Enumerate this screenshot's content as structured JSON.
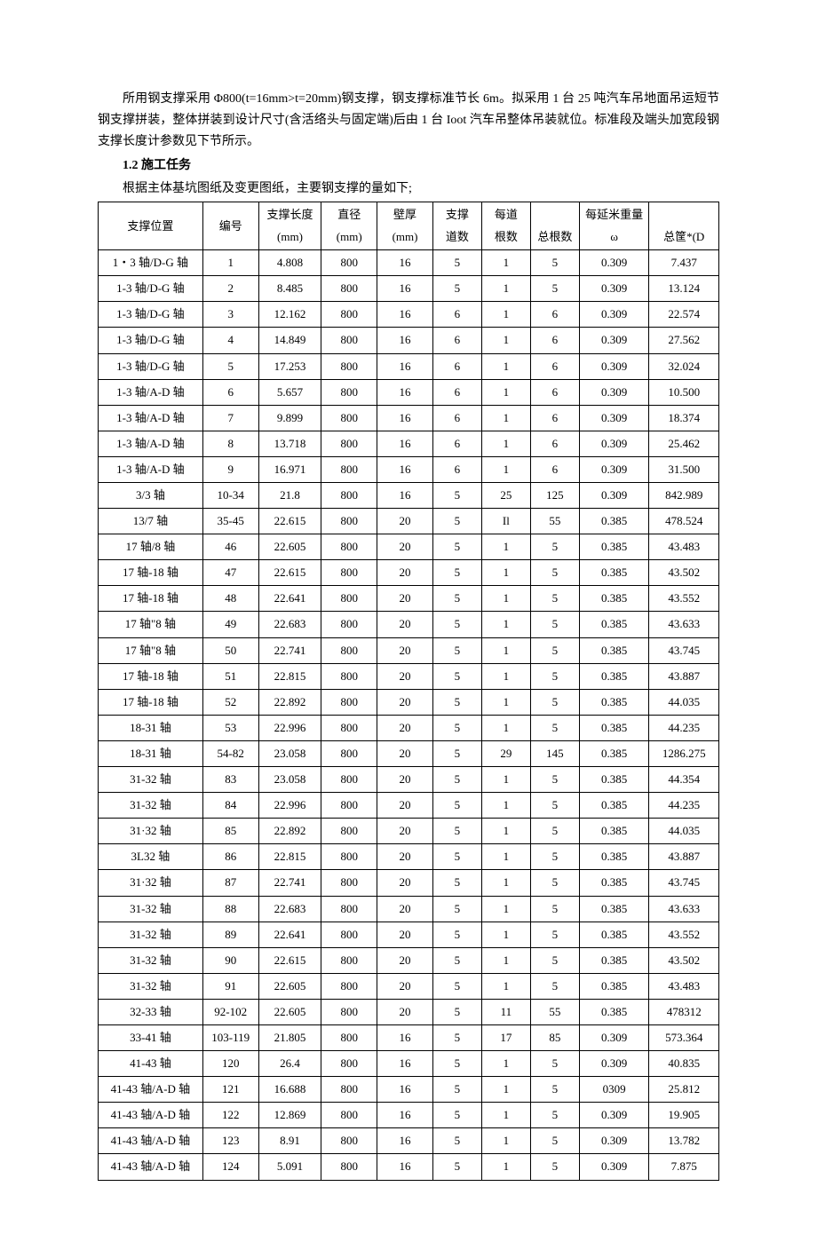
{
  "intro_paragraph": "所用钢支撑采用 Φ800(t=16mm>t=20mm)钢支撑，钢支撑标准节长 6m。拟采用 1 台 25 吨汽车吊地面吊运短节钢支撑拼装，整体拼装到设计尺寸(含活络头与固定端)后由 1 台 Ioot 汽车吊整体吊装就位。标准段及端头加宽段钢支撑长度计参数见下节所示。",
  "section_heading": "1.2 施工任务",
  "intro_line_2": "根据主体基坑图纸及变更图纸，主要钢支撑的量如下;",
  "headers": {
    "pos": "支撑位置",
    "num": "编号",
    "len_top": "支撑长度",
    "len_sub": "(mm)",
    "dia_top": "直径",
    "dia_sub": "(mm)",
    "thk_top": "壁厚",
    "thk_sub": "(mm)",
    "lanes_top": "支撑",
    "lanes_sub": "道数",
    "per_top": "每道",
    "per_sub": "根数",
    "total_sub": "总根数",
    "perm_top": "每延米重量",
    "perm_sub": "ω",
    "sum_sub": "总筐*(D"
  },
  "rows": [
    {
      "pos": "1・3 轴/D-G 轴",
      "num": "1",
      "len": "4.808",
      "dia": "800",
      "thk": "16",
      "lanes": "5",
      "per": "1",
      "total": "5",
      "perm": "0.309",
      "sum": "7.437"
    },
    {
      "pos": "1-3 轴/D-G 轴",
      "num": "2",
      "len": "8.485",
      "dia": "800",
      "thk": "16",
      "lanes": "5",
      "per": "1",
      "total": "5",
      "perm": "0.309",
      "sum": "13.124"
    },
    {
      "pos": "1-3 轴/D-G 轴",
      "num": "3",
      "len": "12.162",
      "dia": "800",
      "thk": "16",
      "lanes": "6",
      "per": "1",
      "total": "6",
      "perm": "0.309",
      "sum": "22.574"
    },
    {
      "pos": "1-3 轴/D-G 轴",
      "num": "4",
      "len": "14.849",
      "dia": "800",
      "thk": "16",
      "lanes": "6",
      "per": "1",
      "total": "6",
      "perm": "0.309",
      "sum": "27.562"
    },
    {
      "pos": "1-3 轴/D-G 轴",
      "num": "5",
      "len": "17.253",
      "dia": "800",
      "thk": "16",
      "lanes": "6",
      "per": "1",
      "total": "6",
      "perm": "0.309",
      "sum": "32.024"
    },
    {
      "pos": "1-3 轴/A-D 轴",
      "num": "6",
      "len": "5.657",
      "dia": "800",
      "thk": "16",
      "lanes": "6",
      "per": "1",
      "total": "6",
      "perm": "0.309",
      "sum": "10.500"
    },
    {
      "pos": "1-3 轴/A-D 轴",
      "num": "7",
      "len": "9.899",
      "dia": "800",
      "thk": "16",
      "lanes": "6",
      "per": "1",
      "total": "6",
      "perm": "0.309",
      "sum": "18.374"
    },
    {
      "pos": "1-3 轴/A-D 轴",
      "num": "8",
      "len": "13.718",
      "dia": "800",
      "thk": "16",
      "lanes": "6",
      "per": "1",
      "total": "6",
      "perm": "0.309",
      "sum": "25.462"
    },
    {
      "pos": "1-3 轴/A-D 轴",
      "num": "9",
      "len": "16.971",
      "dia": "800",
      "thk": "16",
      "lanes": "6",
      "per": "1",
      "total": "6",
      "perm": "0.309",
      "sum": "31.500"
    },
    {
      "pos": "3/3 轴",
      "num": "10-34",
      "len": "21.8",
      "dia": "800",
      "thk": "16",
      "lanes": "5",
      "per": "25",
      "total": "125",
      "perm": "0.309",
      "sum": "842.989"
    },
    {
      "pos": "13/7 轴",
      "num": "35-45",
      "len": "22.615",
      "dia": "800",
      "thk": "20",
      "lanes": "5",
      "per": "Il",
      "total": "55",
      "perm": "0.385",
      "sum": "478.524"
    },
    {
      "pos": "17 轴/8 轴",
      "num": "46",
      "len": "22.605",
      "dia": "800",
      "thk": "20",
      "lanes": "5",
      "per": "1",
      "total": "5",
      "perm": "0.385",
      "sum": "43.483"
    },
    {
      "pos": "17 轴-18 轴",
      "num": "47",
      "len": "22.615",
      "dia": "800",
      "thk": "20",
      "lanes": "5",
      "per": "1",
      "total": "5",
      "perm": "0.385",
      "sum": "43.502"
    },
    {
      "pos": "17 轴-18 轴",
      "num": "48",
      "len": "22.641",
      "dia": "800",
      "thk": "20",
      "lanes": "5",
      "per": "1",
      "total": "5",
      "perm": "0.385",
      "sum": "43.552"
    },
    {
      "pos": "17 轴\"8 轴",
      "num": "49",
      "len": "22.683",
      "dia": "800",
      "thk": "20",
      "lanes": "5",
      "per": "1",
      "total": "5",
      "perm": "0.385",
      "sum": "43.633"
    },
    {
      "pos": "17 轴\"8 轴",
      "num": "50",
      "len": "22.741",
      "dia": "800",
      "thk": "20",
      "lanes": "5",
      "per": "1",
      "total": "5",
      "perm": "0.385",
      "sum": "43.745"
    },
    {
      "pos": "17 轴-18 轴",
      "num": "51",
      "len": "22.815",
      "dia": "800",
      "thk": "20",
      "lanes": "5",
      "per": "1",
      "total": "5",
      "perm": "0.385",
      "sum": "43.887"
    },
    {
      "pos": "17 轴-18 轴",
      "num": "52",
      "len": "22.892",
      "dia": "800",
      "thk": "20",
      "lanes": "5",
      "per": "1",
      "total": "5",
      "perm": "0.385",
      "sum": "44.035"
    },
    {
      "pos": "18-31 轴",
      "num": "53",
      "len": "22.996",
      "dia": "800",
      "thk": "20",
      "lanes": "5",
      "per": "1",
      "total": "5",
      "perm": "0.385",
      "sum": "44.235"
    },
    {
      "pos": "18-31 轴",
      "num": "54-82",
      "len": "23.058",
      "dia": "800",
      "thk": "20",
      "lanes": "5",
      "per": "29",
      "total": "145",
      "perm": "0.385",
      "sum": "1286.275"
    },
    {
      "pos": "31-32 轴",
      "num": "83",
      "len": "23.058",
      "dia": "800",
      "thk": "20",
      "lanes": "5",
      "per": "1",
      "total": "5",
      "perm": "0.385",
      "sum": "44.354"
    },
    {
      "pos": "31-32 轴",
      "num": "84",
      "len": "22.996",
      "dia": "800",
      "thk": "20",
      "lanes": "5",
      "per": "1",
      "total": "5",
      "perm": "0.385",
      "sum": "44.235"
    },
    {
      "pos": "31·32 轴",
      "num": "85",
      "len": "22.892",
      "dia": "800",
      "thk": "20",
      "lanes": "5",
      "per": "1",
      "total": "5",
      "perm": "0.385",
      "sum": "44.035"
    },
    {
      "pos": "3L32 轴",
      "num": "86",
      "len": "22.815",
      "dia": "800",
      "thk": "20",
      "lanes": "5",
      "per": "1",
      "total": "5",
      "perm": "0.385",
      "sum": "43.887"
    },
    {
      "pos": "31·32 轴",
      "num": "87",
      "len": "22.741",
      "dia": "800",
      "thk": "20",
      "lanes": "5",
      "per": "1",
      "total": "5",
      "perm": "0.385",
      "sum": "43.745"
    },
    {
      "pos": "31-32 轴",
      "num": "88",
      "len": "22.683",
      "dia": "800",
      "thk": "20",
      "lanes": "5",
      "per": "1",
      "total": "5",
      "perm": "0.385",
      "sum": "43.633"
    },
    {
      "pos": "31-32 轴",
      "num": "89",
      "len": "22.641",
      "dia": "800",
      "thk": "20",
      "lanes": "5",
      "per": "1",
      "total": "5",
      "perm": "0.385",
      "sum": "43.552"
    },
    {
      "pos": "31-32 轴",
      "num": "90",
      "len": "22.615",
      "dia": "800",
      "thk": "20",
      "lanes": "5",
      "per": "1",
      "total": "5",
      "perm": "0.385",
      "sum": "43.502"
    },
    {
      "pos": "31-32 轴",
      "num": "91",
      "len": "22.605",
      "dia": "800",
      "thk": "20",
      "lanes": "5",
      "per": "1",
      "total": "5",
      "perm": "0.385",
      "sum": "43.483"
    },
    {
      "pos": "32-33 轴",
      "num": "92-102",
      "len": "22.605",
      "dia": "800",
      "thk": "20",
      "lanes": "5",
      "per": "11",
      "total": "55",
      "perm": "0.385",
      "sum": "478312"
    },
    {
      "pos": "33-41 轴",
      "num": "103-119",
      "len": "21.805",
      "dia": "800",
      "thk": "16",
      "lanes": "5",
      "per": "17",
      "total": "85",
      "perm": "0.309",
      "sum": "573.364"
    },
    {
      "pos": "41-43 轴",
      "num": "120",
      "len": "26.4",
      "dia": "800",
      "thk": "16",
      "lanes": "5",
      "per": "1",
      "total": "5",
      "perm": "0.309",
      "sum": "40.835"
    },
    {
      "pos": "41-43 轴/A-D 轴",
      "num": "121",
      "len": "16.688",
      "dia": "800",
      "thk": "16",
      "lanes": "5",
      "per": "1",
      "total": "5",
      "perm": "0309",
      "sum": "25.812"
    },
    {
      "pos": "41-43 轴/A-D 轴",
      "num": "122",
      "len": "12.869",
      "dia": "800",
      "thk": "16",
      "lanes": "5",
      "per": "1",
      "total": "5",
      "perm": "0.309",
      "sum": "19.905"
    },
    {
      "pos": "41-43 轴/A-D 轴",
      "num": "123",
      "len": "8.91",
      "dia": "800",
      "thk": "16",
      "lanes": "5",
      "per": "1",
      "total": "5",
      "perm": "0.309",
      "sum": "13.782"
    },
    {
      "pos": "41-43 轴/A-D 轴",
      "num": "124",
      "len": "5.091",
      "dia": "800",
      "thk": "16",
      "lanes": "5",
      "per": "1",
      "total": "5",
      "perm": "0.309",
      "sum": "7.875"
    }
  ]
}
